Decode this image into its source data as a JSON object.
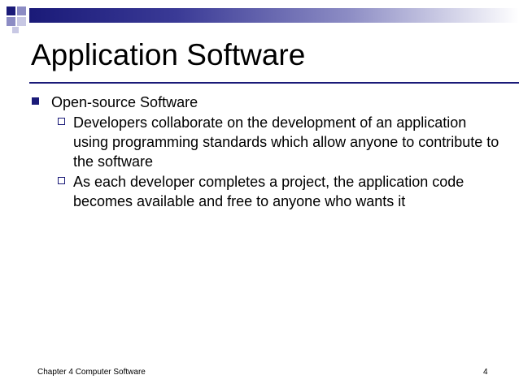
{
  "slide": {
    "title": "Application Software",
    "bullets": [
      {
        "text": "Open-source Software",
        "sub_bullets": [
          "Developers collaborate on the development of an application using programming standards which allow anyone to contribute to the software",
          "As each developer completes a project, the application code becomes available and free to anyone who wants it"
        ]
      }
    ]
  },
  "footer": {
    "left_text": "Chapter 4 Computer Software",
    "page_number": "4"
  },
  "colors": {
    "accent": "#1a1a78",
    "accent_light": "#8c8cc4",
    "background": "#ffffff",
    "text": "#000000"
  },
  "icons": {
    "level1_bullet": "filled-square-bullet-icon",
    "level2_bullet": "hollow-square-bullet-icon"
  }
}
